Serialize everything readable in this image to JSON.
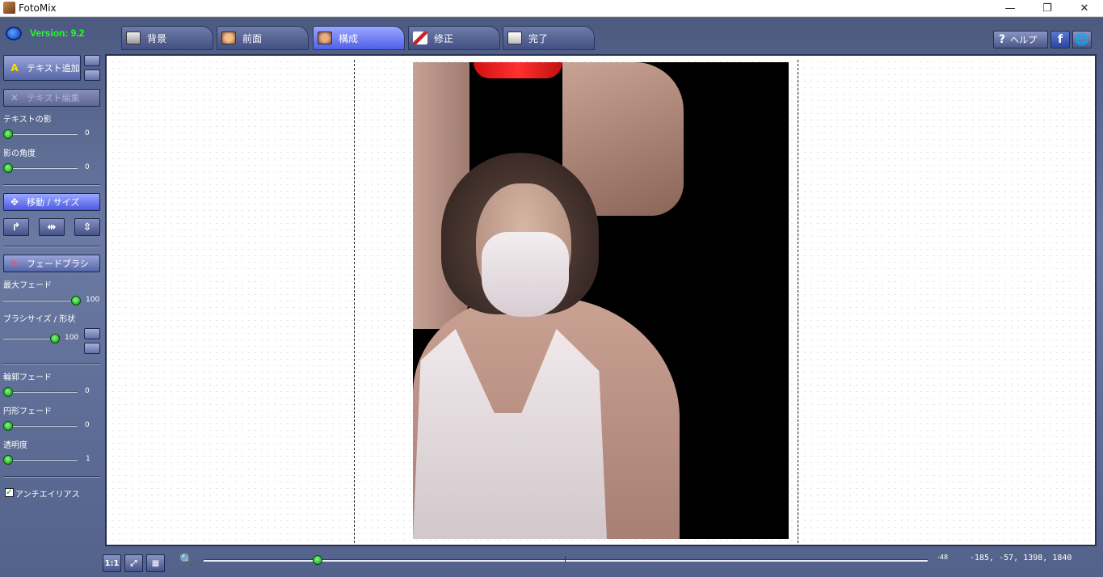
{
  "window": {
    "title": "FotoMix",
    "minimize": "—",
    "maximize": "❐",
    "close": "✕"
  },
  "version": "Version: 9.2",
  "tabs": [
    {
      "label": "背景",
      "active": false
    },
    {
      "label": "前面",
      "active": false
    },
    {
      "label": "構成",
      "active": true
    },
    {
      "label": "修正",
      "active": false
    },
    {
      "label": "完了",
      "active": false
    }
  ],
  "top_buttons": {
    "help": "ヘルプ",
    "facebook": "f",
    "web": "🌐"
  },
  "panel": {
    "add_text": "テキスト追加",
    "edit_text": "テキスト編集",
    "text_shadow": {
      "label": "テキストの影",
      "value": 0
    },
    "shadow_angle": {
      "label": "影の角度",
      "value": 0
    },
    "move_size": "移動 / サイズ",
    "fade_brush": "フェードブラシ",
    "max_fade": {
      "label": "最大フェード",
      "value": 100
    },
    "brush_size": {
      "label": "ブラシサイズ / 形状",
      "value": 100
    },
    "edge_fade": {
      "label": "輪郭フェード",
      "value": 0
    },
    "circular_fade": {
      "label": "円形フェード",
      "value": 0
    },
    "transparency": {
      "label": "透明度",
      "value": 1
    },
    "antialias": {
      "label": "アンチエイリアス",
      "checked": true
    }
  },
  "bottom": {
    "btn_1to1": "1:1",
    "zoom_value": "-48",
    "coords": "-185, -57, 1398, 1840"
  },
  "colors": {
    "accent": "#22ff22",
    "frame": "#5a6a90",
    "tab_active": "#6070f0"
  }
}
